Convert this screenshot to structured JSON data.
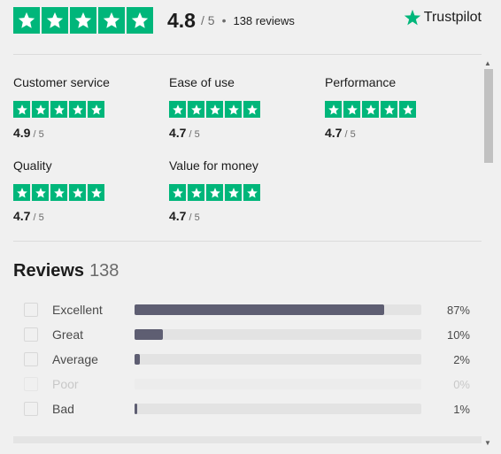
{
  "summary": {
    "score": "4.8",
    "out_of": "/ 5",
    "separator": "•",
    "review_count": "138 reviews",
    "brand": "Trustpilot",
    "brand_color": "#00b67a"
  },
  "categories": [
    {
      "name": "Customer service",
      "score": "4.9",
      "out_of": "/ 5"
    },
    {
      "name": "Ease of use",
      "score": "4.7",
      "out_of": "/ 5"
    },
    {
      "name": "Performance",
      "score": "4.7",
      "out_of": "/ 5"
    },
    {
      "name": "Quality",
      "score": "4.7",
      "out_of": "/ 5"
    },
    {
      "name": "Value for money",
      "score": "4.7",
      "out_of": "/ 5"
    }
  ],
  "reviews": {
    "title": "Reviews",
    "total": "138",
    "breakdown": [
      {
        "label": "Excellent",
        "percent_text": "87%",
        "percent": 87,
        "enabled": true
      },
      {
        "label": "Great",
        "percent_text": "10%",
        "percent": 10,
        "enabled": true
      },
      {
        "label": "Average",
        "percent_text": "2%",
        "percent": 2,
        "enabled": true
      },
      {
        "label": "Poor",
        "percent_text": "0%",
        "percent": 0,
        "enabled": false
      },
      {
        "label": "Bad",
        "percent_text": "1%",
        "percent": 1,
        "enabled": true
      }
    ]
  },
  "scrollbar": {
    "up_arrow": "▲",
    "down_arrow": "▼"
  }
}
